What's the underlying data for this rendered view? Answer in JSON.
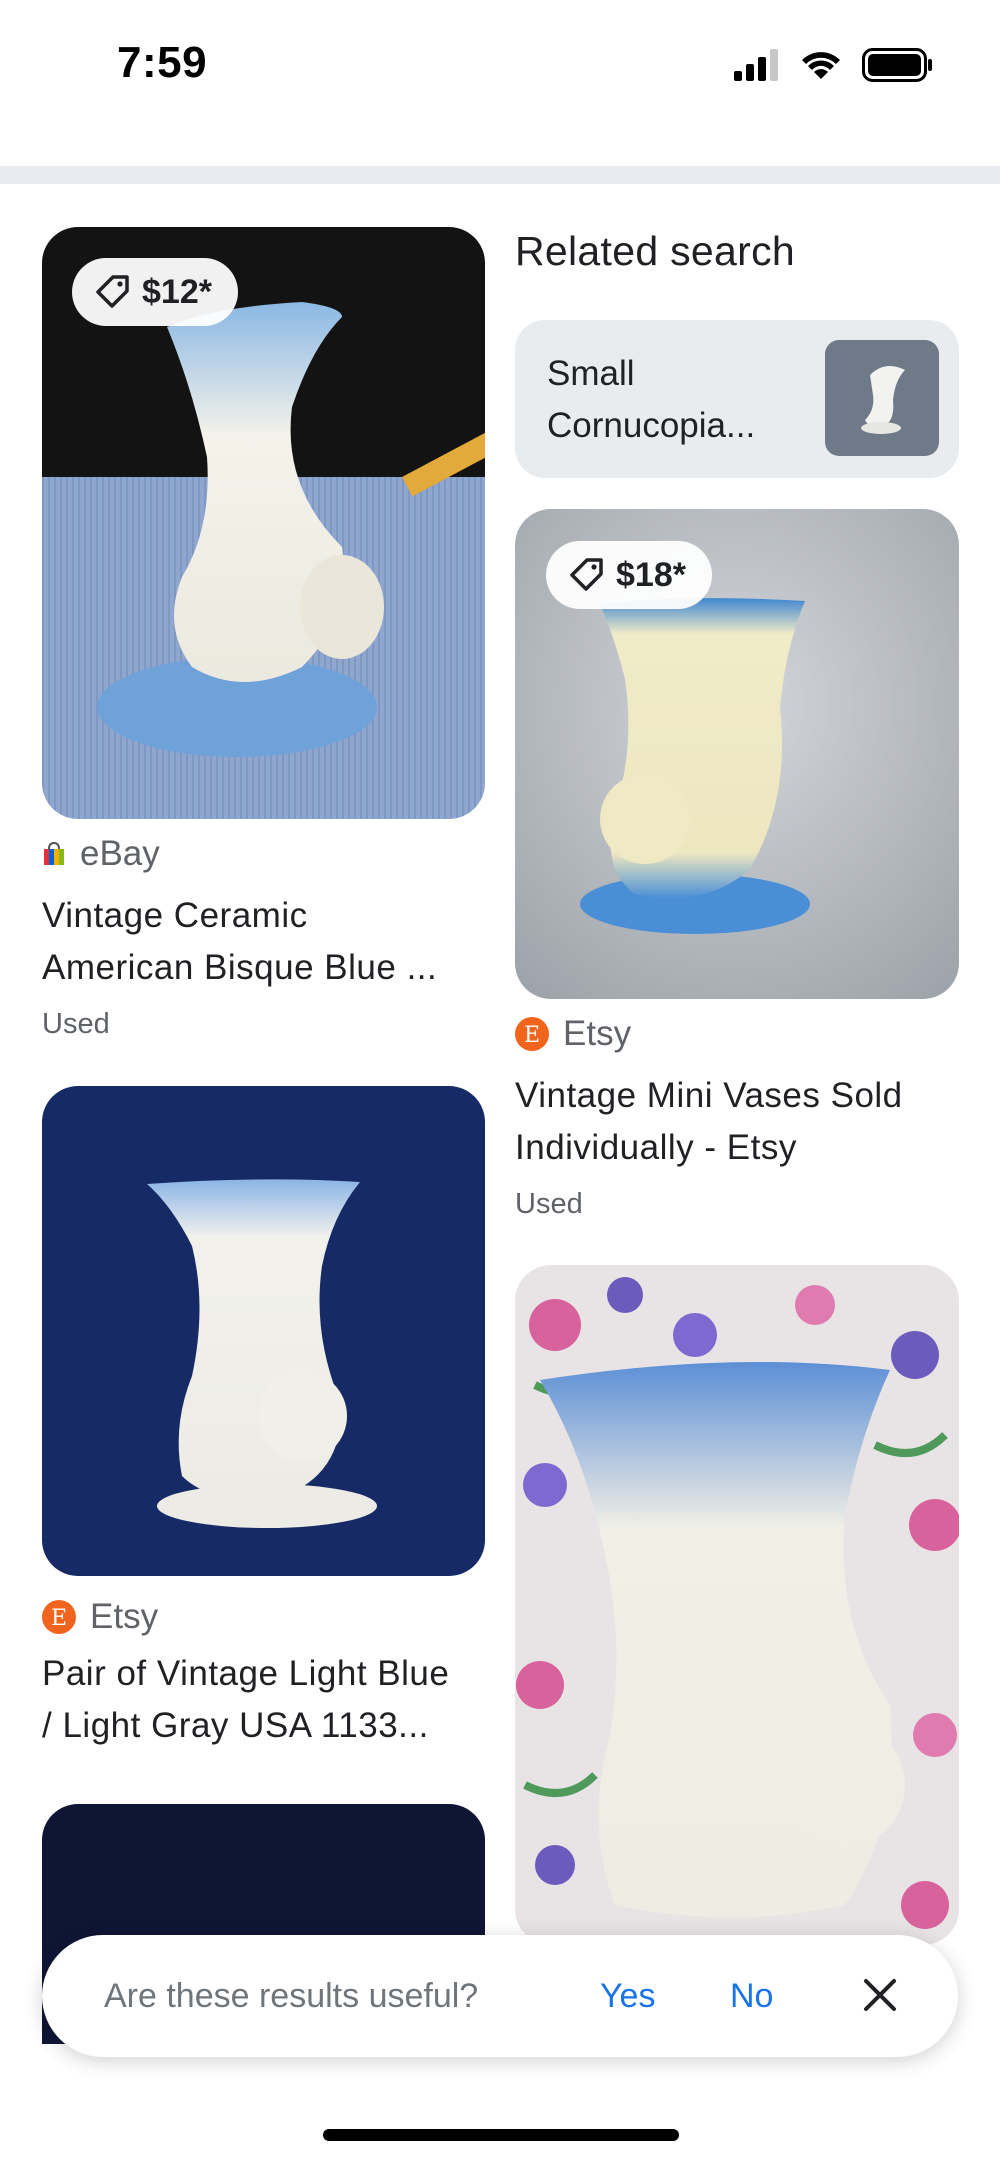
{
  "status_bar": {
    "time": "7:59"
  },
  "results": [
    {
      "price": "$12*",
      "source": "eBay",
      "title_line1": "Vintage Ceramic",
      "title_line2": "American Bisque Blue ...",
      "condition": "Used"
    },
    {
      "price": "$18*",
      "source": "Etsy",
      "title_line1": "Vintage Mini Vases Sold",
      "title_line2": "Individually - Etsy",
      "condition": "Used"
    },
    {
      "source": "Etsy",
      "title_line1": "Pair of Vintage Light Blue",
      "title_line2": "/ Light Gray USA 1133..."
    }
  ],
  "related": {
    "heading": "Related search",
    "query_line1": "Small",
    "query_line2": "Cornucopia..."
  },
  "feedback": {
    "question": "Are these results useful?",
    "yes": "Yes",
    "no": "No"
  },
  "colors": {
    "accent": "#1a73e8",
    "etsy_orange": "#f1641e"
  },
  "icons": [
    "tag-icon",
    "ebay-bag-icon",
    "etsy-logo-icon",
    "close-icon",
    "signal-icon",
    "wifi-icon",
    "battery-icon"
  ]
}
